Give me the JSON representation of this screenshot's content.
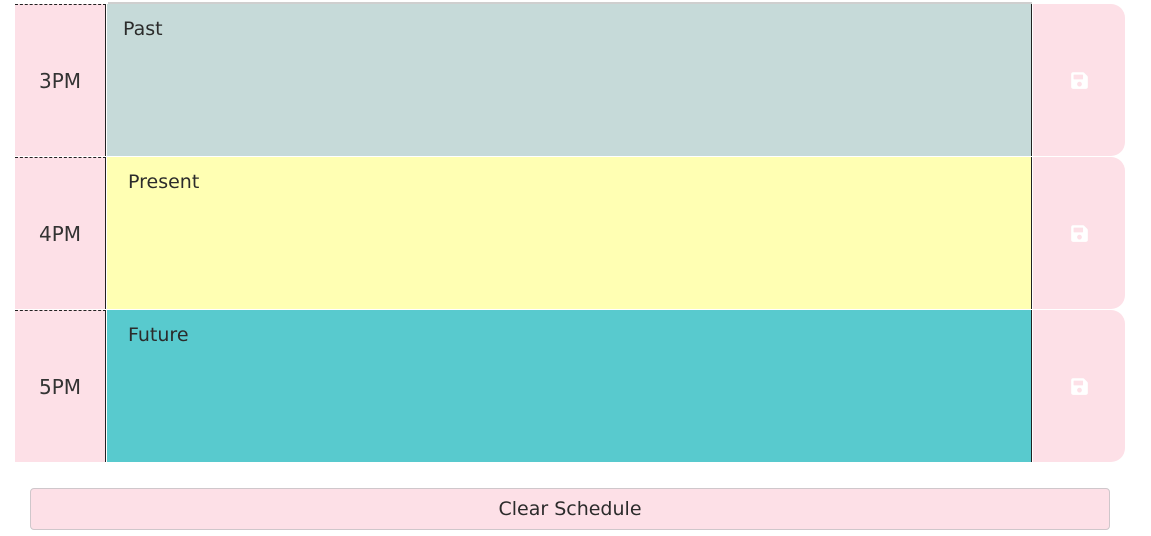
{
  "rows": [
    {
      "hour": "3PM",
      "text": "Past",
      "state": "past"
    },
    {
      "hour": "4PM",
      "text": "Present",
      "state": "present"
    },
    {
      "hour": "5PM",
      "text": "Future",
      "state": "future"
    }
  ],
  "save_icon": "floppy-disk-icon",
  "clear_button": {
    "label": "Clear Schedule"
  },
  "colors": {
    "past": "#c6dad9",
    "present": "#ffffb3",
    "future": "#58cace",
    "hour_bg": "#fde0e7",
    "save_icon": "#ffffff"
  }
}
